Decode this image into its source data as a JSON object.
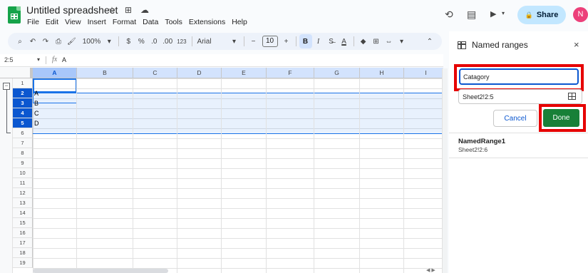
{
  "header": {
    "doc_title": "Untitled spreadsheet",
    "title_icons": [
      "☆",
      "⊞",
      "☁"
    ],
    "menu": [
      "File",
      "Edit",
      "View",
      "Insert",
      "Format",
      "Data",
      "Tools",
      "Extensions",
      "Help"
    ],
    "share_label": "Share",
    "avatar_initial": "N",
    "icons": {
      "history": "⟲",
      "comment": "▤",
      "meet": "▶",
      "lock": "🔒"
    }
  },
  "toolbar": {
    "items": [
      "⌕",
      "↶",
      "↷",
      "⎙",
      "🖌",
      "100%",
      "▾",
      "$",
      "%",
      ".0",
      ".00",
      "123",
      "Arial",
      "▾",
      "−",
      "10",
      "+",
      "B",
      "I",
      "S̶",
      "A",
      "◆",
      "⊞",
      "⇔",
      "▾",
      "⌃"
    ],
    "zoom": "100%",
    "font": "Arial",
    "font_size": "10"
  },
  "formula_bar": {
    "name_box": "2:5",
    "fx": "fx",
    "value": "A"
  },
  "grid": {
    "columns": [
      "A",
      "B",
      "C",
      "D",
      "E",
      "F",
      "G",
      "H",
      "I"
    ],
    "rows": [
      "1",
      "2",
      "3",
      "4",
      "5",
      "6",
      "7",
      "8",
      "9",
      "10",
      "11",
      "12",
      "13",
      "14",
      "15",
      "16",
      "17",
      "18",
      "19"
    ],
    "cells": [
      {
        "ref": "A2",
        "value": "A"
      },
      {
        "ref": "A3",
        "value": "B"
      },
      {
        "ref": "A4",
        "value": "C"
      },
      {
        "ref": "A5",
        "value": "D"
      }
    ]
  },
  "panel": {
    "title": "Named ranges",
    "close": "×",
    "name_value": "Catagory",
    "range_value": "Sheet2!2:5",
    "cancel_label": "Cancel",
    "done_label": "Done",
    "existing": [
      {
        "name": "NamedRange1",
        "range": "Sheet2!2:6"
      }
    ]
  },
  "colors": {
    "accent": "#0b57d0",
    "done": "#188038",
    "highlight": "#e60000"
  }
}
